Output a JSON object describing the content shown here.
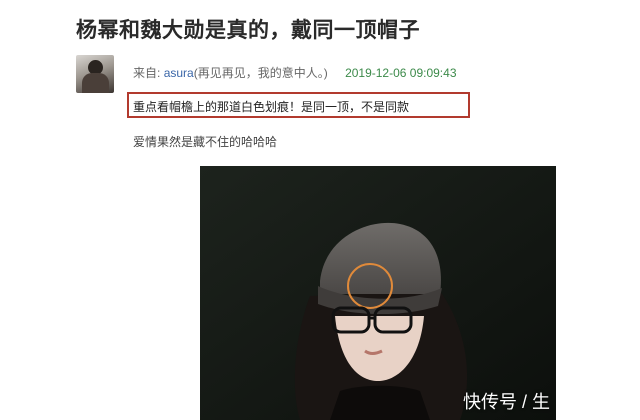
{
  "article": {
    "title": "杨幂和魏大勋是真的，戴同一顶帽子"
  },
  "post": {
    "from_label": "来自:",
    "author": "asura",
    "author_note": "(再见再见，我的意中人。)",
    "timestamp": "2019-12-06 09:09:43",
    "highlight_text": "重点看帽檐上的那道白色划痕！是同一顶，不是同款",
    "comment": "爱情果然是藏不住的哈哈哈"
  },
  "watermark": {
    "text": "快传号 / 生"
  },
  "colors": {
    "highlight_border": "#b23a2e",
    "author_link": "#3a66a8",
    "timestamp": "#3c8a4a"
  }
}
